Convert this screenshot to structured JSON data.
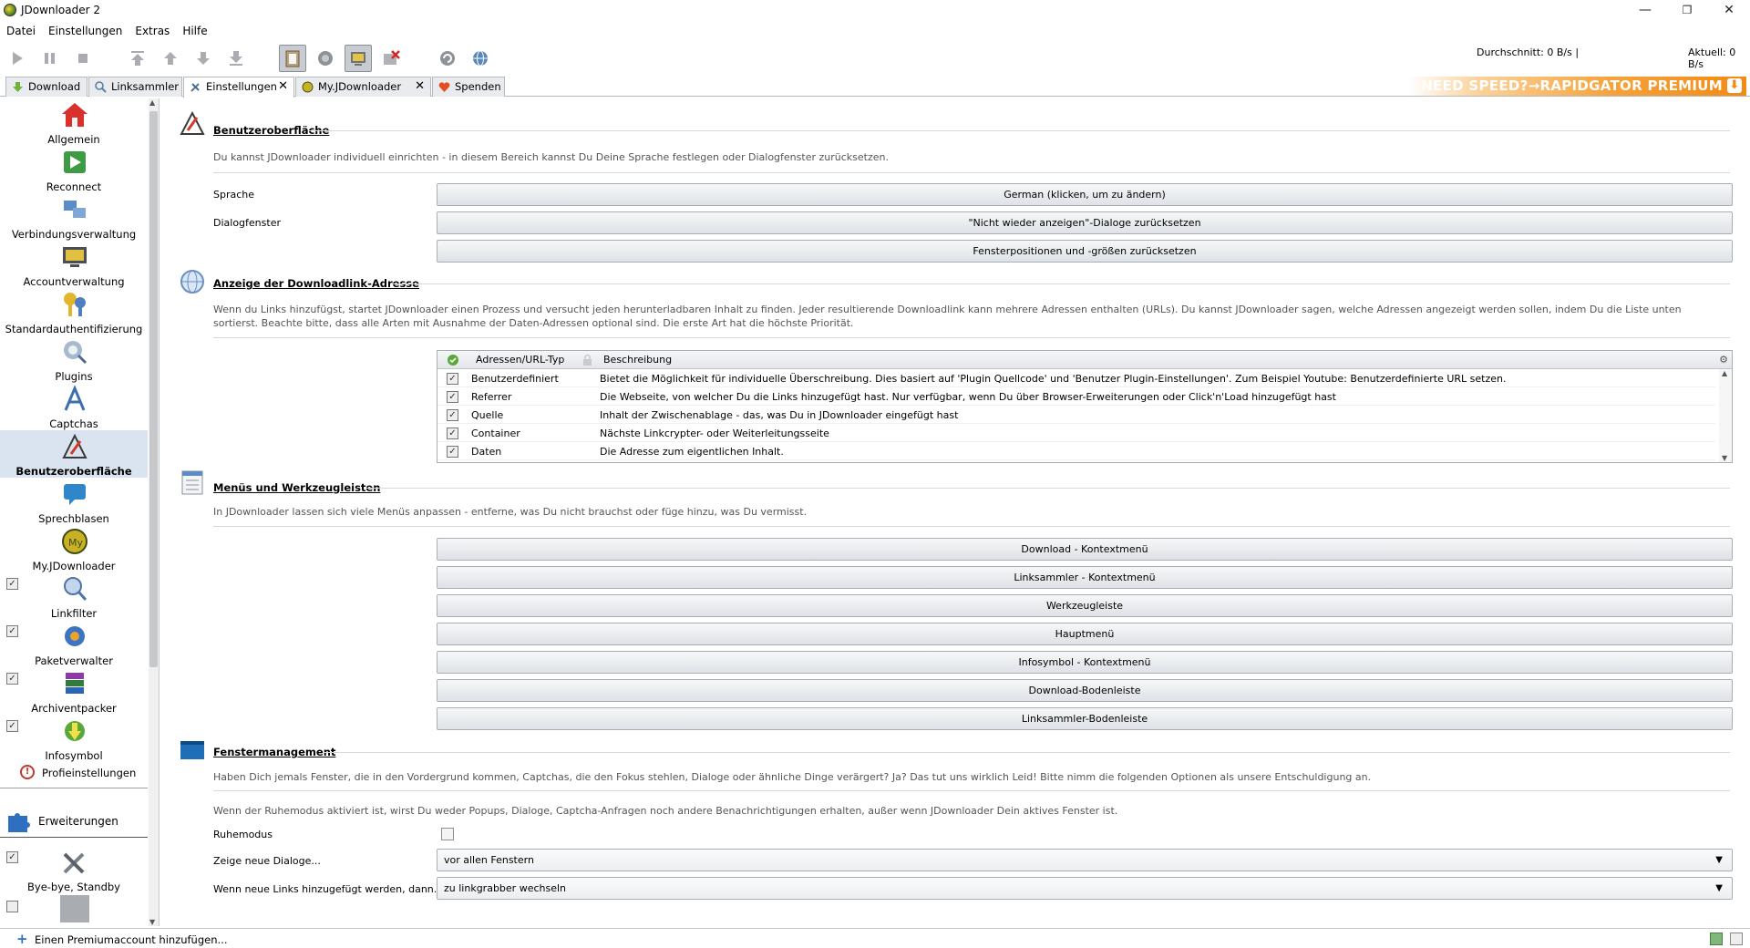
{
  "window": {
    "title": "JDownloader 2",
    "minimize": "—",
    "restore": "❐",
    "close": "✕"
  },
  "menu": [
    "Datei",
    "Einstellungen",
    "Extras",
    "Hilfe"
  ],
  "speed": {
    "average": "Durchschnitt: 0 B/s |",
    "current": "Aktuell: 0 B/s"
  },
  "tabs": [
    {
      "label": "Download",
      "closable": false
    },
    {
      "label": "Linksammler",
      "closable": false
    },
    {
      "label": "Einstellungen",
      "closable": true
    },
    {
      "label": "My.JDownloader",
      "closable": true
    },
    {
      "label": "Spenden",
      "closable": false
    }
  ],
  "promo": {
    "text": "NEED SPEED?→RAPIDGATOR PREMIUM",
    "icon": "download-icon"
  },
  "sidebar": {
    "items": [
      {
        "label": "Allgemein",
        "icon": "house-icon"
      },
      {
        "label": "Reconnect",
        "icon": "reconnect-icon"
      },
      {
        "label": "Verbindungsverwaltung",
        "icon": "network-icon"
      },
      {
        "label": "Accountverwaltung",
        "icon": "account-icon"
      },
      {
        "label": "Standardauthentifizierung",
        "icon": "keys-icon"
      },
      {
        "label": "Plugins",
        "icon": "plugins-icon"
      },
      {
        "label": "Captchas",
        "icon": "captcha-icon"
      },
      {
        "label": "Benutzeroberfläche",
        "icon": "ui-icon"
      },
      {
        "label": "Sprechblasen",
        "icon": "bubble-icon"
      },
      {
        "label": "My.JDownloader",
        "icon": "myjd-icon"
      },
      {
        "label": "Linkfilter",
        "icon": "filter-icon"
      },
      {
        "label": "Paketverwalter",
        "icon": "package-icon"
      },
      {
        "label": "Archiventpacker",
        "icon": "archive-icon"
      },
      {
        "label": "Infosymbol",
        "icon": "info-icon"
      }
    ],
    "checked": [
      "✓",
      "✓",
      "✓",
      "✓",
      "✓"
    ],
    "profile": "Profieinstellungen",
    "extensions": "Erweiterungen",
    "ext_items": [
      {
        "label": "Bye-bye, Standby",
        "checked": true
      }
    ]
  },
  "sections": {
    "ui": {
      "title": "Benutzeroberfläche",
      "desc": "Du kannst JDownloader individuell einrichten - in diesem Bereich kannst Du Deine Sprache festlegen oder Dialogfenster zurücksetzen.",
      "language_label": "Sprache",
      "language_button": "German (klicken, um zu ändern)",
      "dialog_label": "Dialogfenster",
      "dialog_reset": "\"Nicht wieder anzeigen\"-Dialoge zurücksetzen",
      "window_reset": "Fensterpositionen und -größen zurücksetzen"
    },
    "address": {
      "title": "Anzeige der Downloadlink-Adresse",
      "desc": "Wenn du Links hinzufügst, startet JDownloader einen Prozess und versucht jeden herunterladbaren Inhalt zu finden. Jeder resultierende Downloadlink kann mehrere Adressen enthalten (URLs). Du kannst JDownloader sagen, welche Adressen angezeigt werden sollen, indem Du die Liste unten sortierst. Beachte bitte, dass alle Arten mit Ausnahme der Daten-Adressen optional sind. Die erste Art hat die höchste Priorität.",
      "col_type": "Adressen/URL-Typ",
      "col_desc": "Beschreibung",
      "rows": [
        {
          "type": "Benutzerdefiniert",
          "desc": "Bietet die Möglichkeit für individuelle Überschreibung. Dies basiert auf 'Plugin Quellcode' und 'Benutzer Plugin-Einstellungen'. Zum Beispiel Youtube: Benutzerdefinierte URL setzen."
        },
        {
          "type": "Referrer",
          "desc": "Die Webseite, von welcher Du die Links hinzugefügt hast. Nur verfügbar, wenn Du über Browser-Erweiterungen oder Click'n'Load hinzugefügt hast"
        },
        {
          "type": "Quelle",
          "desc": "Inhalt der Zwischenablage - das, was Du in JDownloader eingefügt hast"
        },
        {
          "type": "Container",
          "desc": "Nächste Linkcrypter- oder Weiterleitungsseite"
        },
        {
          "type": "Daten",
          "desc": "Die Adresse zum eigentlichen Inhalt."
        }
      ],
      "check": "✓"
    },
    "menus": {
      "title": "Menüs und Werkzeugleisten",
      "desc": "In JDownloader lassen sich viele Menüs anpassen - entferne, was Du nicht brauchst oder füge hinzu, was Du vermisst.",
      "buttons": [
        "Download - Kontextmenü",
        "Linksammler - Kontextmenü",
        "Werkzeugleiste",
        "Hauptmenü",
        "Infosymbol - Kontextmenü",
        "Download-Bodenleiste",
        "Linksammler-Bodenleiste"
      ]
    },
    "window": {
      "title": "Fenstermanagement",
      "desc1": "Haben Dich jemals Fenster, die in den Vordergrund kommen, Captchas, die den Fokus stehlen, Dialoge oder ähnliche Dinge verärgert? Ja? Das tut uns wirklich Leid! Bitte nimm die folgenden Optionen als unsere Entschuldigung an.",
      "desc2": "Wenn der Ruhemodus aktiviert ist, wirst Du weder Popups, Dialoge, Captcha-Anfragen noch andere Benachrichtigungen erhalten, außer wenn JDownloader Dein aktives Fenster ist.",
      "silent_label": "Ruhemodus",
      "silent_checked": false,
      "new_dialogs_label": "Zeige neue Dialoge...",
      "new_dialogs_value": "vor allen Fenstern",
      "new_links_label": "Wenn neue Links hinzugefügt werden, dann...",
      "new_links_value": "zu linkgrabber wechseln"
    }
  },
  "status": {
    "text": "Einen Premiumaccount hinzufügen..."
  },
  "colors": {
    "accent": "#f28a14",
    "selection": "#d9e4f0"
  }
}
